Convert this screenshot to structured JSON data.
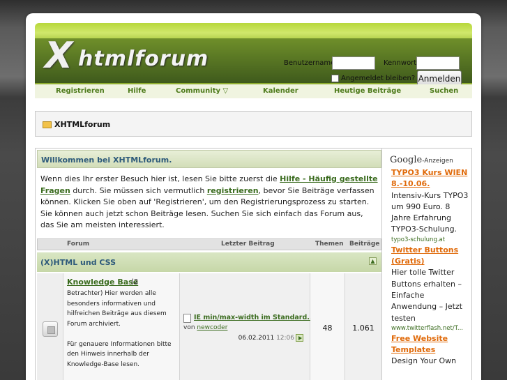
{
  "header": {
    "logo_x": "X",
    "logo_text": "htmlforum",
    "username_label": "Benutzername",
    "password_label": "Kennwort",
    "username_value": "",
    "password_value": "",
    "remember_label": "Angemeldet bleiben?",
    "login_button": "Anmelden"
  },
  "nav": {
    "items": [
      "Registrieren",
      "Hilfe",
      "Community ▽",
      "Kalender",
      "Heutige Beiträge",
      "Suchen"
    ]
  },
  "breadcrumb": {
    "title": "XHTMLforum"
  },
  "welcome": {
    "title": "Willkommen bei XHTMLforum.",
    "text1": "Wenn dies Ihr erster Besuch hier ist, lesen Sie bitte zuerst die ",
    "link1": "Hilfe - Häufig gestellte Fragen",
    "text2": " durch. Sie müssen sich vermutlich ",
    "link2": "registrieren",
    "text3": ", bevor Sie Beiträge verfassen können. Klicken Sie oben auf 'Registrieren', um den Registrierungsprozess zu starten. Sie können auch jetzt schon Beiträge lesen. Suchen Sie sich einfach das Forum aus, das Sie am meisten interessiert."
  },
  "table": {
    "col_forum": "Forum",
    "col_last": "Letzter Beitrag",
    "col_threads": "Themen",
    "col_posts": "Beiträge"
  },
  "category": {
    "title": "(X)HTML und CSS"
  },
  "forum": {
    "name": "Knowledge Base",
    "viewers": "(2",
    "desc": "Betrachter) Hier werden alle besonders informativen und hilfreichen Beiträge aus diesem Forum archiviert.",
    "desc2": "Für genauere Informationen bitte den Hinweis innerhalb der Knowledge-Base lesen.",
    "last_title": "IE min/max-width im Standard...",
    "last_by_prefix": "von ",
    "last_by_user": "newcoder",
    "last_date": "06.02.2011",
    "last_time": "12:06",
    "threads": "48",
    "posts": "1.061"
  },
  "ads": {
    "google": "Google",
    "label": "-Anzeigen",
    "ad1_title": "TYPO3 Kurs WIEN 8.-10.06.",
    "ad1_text": "Intensiv-Kurs TYPO3 um 990 Euro. 8 Jahre Erfahrung TYPO3-Schulung.",
    "ad1_url": "typo3-schulung.at",
    "ad2_title": "Twitter Buttons (Gratis)",
    "ad2_text": "Hier tolle Twitter Buttons erhalten – Einfache Anwendung – Jetzt testen",
    "ad2_url": "www.twitterflash.net/T...",
    "ad3_title": "Free Website Templates",
    "ad3_text": "Design Your Own"
  },
  "colors": {
    "header_green": "#8aa92f",
    "link_green": "#3a6b1e",
    "ad_orange": "#e06a0a",
    "title_blue": "#2d5a7a"
  }
}
